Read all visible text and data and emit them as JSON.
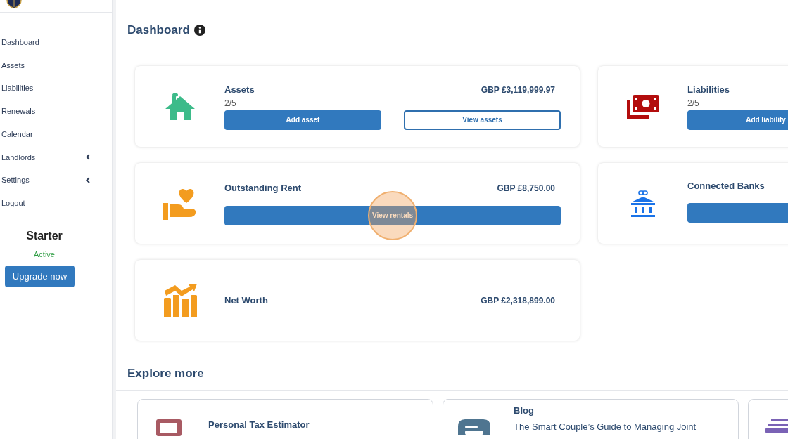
{
  "top_bar": {
    "menu_glyph": "—"
  },
  "sidebar": {
    "items": [
      {
        "label": "Dashboard",
        "expandable": false
      },
      {
        "label": "Assets",
        "expandable": false
      },
      {
        "label": "Liabilities",
        "expandable": false
      },
      {
        "label": "Renewals",
        "expandable": false
      },
      {
        "label": "Calendar",
        "expandable": false
      },
      {
        "label": "Landlords",
        "expandable": true
      },
      {
        "label": "Settings",
        "expandable": true
      },
      {
        "label": "Logout",
        "expandable": false
      }
    ],
    "plan": {
      "name": "Starter",
      "status": "Active"
    },
    "upgrade_button": "Upgrade now"
  },
  "page_title": "Dashboard",
  "cards": [
    {
      "kind": "assets",
      "title": "Assets",
      "count": "2/5",
      "amount": "GBP £3,119,999.97",
      "buttons": [
        {
          "kind": "primary",
          "label": "Add asset"
        },
        {
          "kind": "secondary",
          "label": "View assets"
        }
      ]
    },
    {
      "kind": "liabilities",
      "title": "Liabilities",
      "count": "2/5",
      "buttons": [
        {
          "kind": "primary",
          "label": "Add liability"
        }
      ]
    },
    {
      "kind": "rent",
      "title": "Outstanding Rent",
      "amount": "GBP £8,750.00",
      "buttons": [
        {
          "kind": "primary",
          "label": "View rentals",
          "highlighted": true
        }
      ]
    },
    {
      "kind": "banks",
      "title": "Connected Banks",
      "buttons": [
        {
          "kind": "primary"
        }
      ]
    },
    {
      "kind": "networth",
      "title": "Net Worth",
      "amount": "GBP £2,318,899.00"
    }
  ],
  "explore": {
    "heading": "Explore more",
    "items": [
      {
        "kind": "calculator",
        "title": "Personal Tax Estimator"
      },
      {
        "kind": "blog",
        "title": "Blog",
        "text": "The Smart Couple’s Guide to Managing Joint"
      },
      {
        "kind": "stack"
      }
    ]
  }
}
